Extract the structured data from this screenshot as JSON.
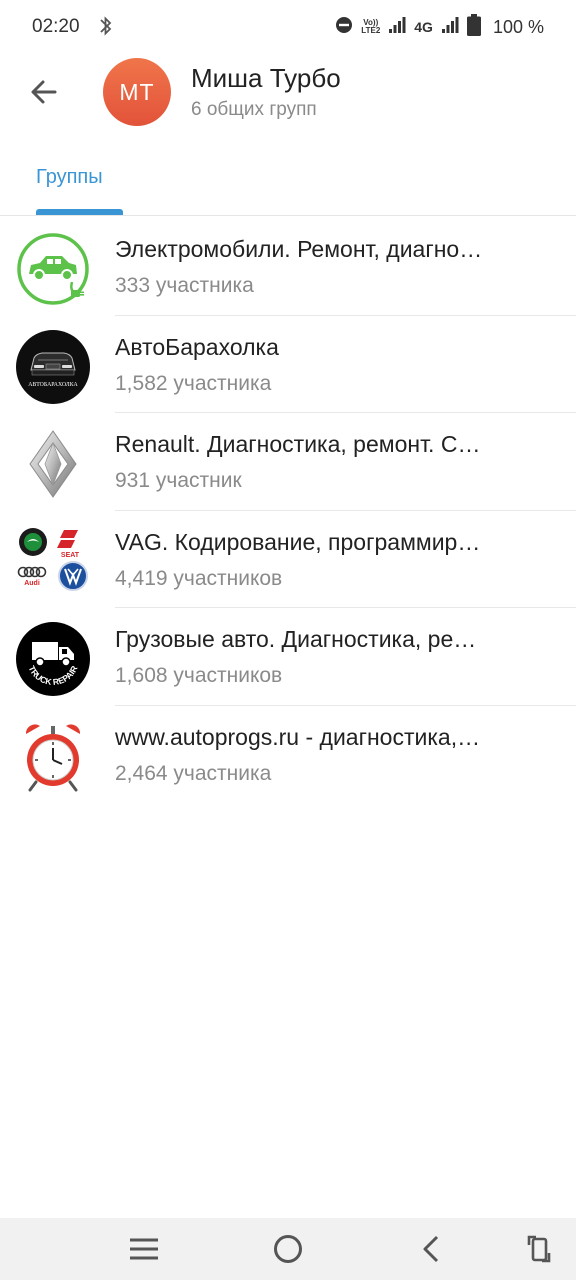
{
  "status_bar": {
    "time": "02:20",
    "lte_top": "Vo))",
    "lte_bottom": "LTE2",
    "network": "4G",
    "battery": "100 %"
  },
  "header": {
    "avatar_initials": "МТ",
    "name": "Миша Турбо",
    "subtitle": "6 общих групп"
  },
  "tabs": [
    {
      "label": "Группы"
    }
  ],
  "groups": [
    {
      "title": "Электромобили. Ремонт, диагно…",
      "members": "333 участника",
      "icon": "electric-car-icon"
    },
    {
      "title": "АвтоБарахолка",
      "members": "1,582 участника",
      "icon": "autobaraholka-logo",
      "logo_text": "АВТОБАРАХОЛКА"
    },
    {
      "title": "Renault. Диагностика, ремонт. С…",
      "members": "931 участник",
      "icon": "renault-logo"
    },
    {
      "title": "VAG. Кодирование, программир…",
      "members": "4,419 участников",
      "icon": "vag-brands-logo",
      "logo_text": [
        "SEAT",
        "Audi"
      ]
    },
    {
      "title": "Грузовые авто. Диагностика, ре…",
      "members": "1,608 участников",
      "icon": "truck-repair-logo",
      "logo_text": "TRUCK REPAIR"
    },
    {
      "title": "www.autoprogs.ru - диагностика,…",
      "members": "2,464 участника",
      "icon": "alarm-clock-icon"
    }
  ],
  "colors": {
    "accent": "#3a95d5",
    "avatar": "#e8603f",
    "muted_text": "#8a8a8a",
    "electric_green": "#5cc24a",
    "alarm_red": "#e23a2c"
  }
}
